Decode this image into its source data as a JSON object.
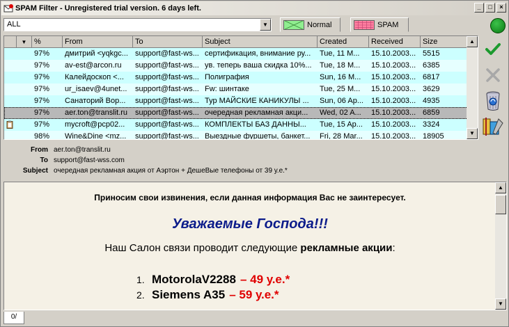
{
  "window": {
    "title": "SPAM Filter - Unregistered trial version. 6 days left."
  },
  "toolbar": {
    "filter_value": "ALL",
    "tab_normal": "Normal",
    "tab_spam": "SPAM",
    "colors": {
      "normal": "#90ee90",
      "spam": "#ff7fa0",
      "status": "#1a9a26"
    }
  },
  "list": {
    "headers": {
      "sort": "▼",
      "pct": "%",
      "from": "From",
      "to": "To",
      "subject": "Subject",
      "created": "Created",
      "received": "Received",
      "size": "Size"
    },
    "rows": [
      {
        "pct": "97%",
        "from": "дмитрий <yqkgc...",
        "to": "support@fast-ws...",
        "subject": "сертификация, внимание ру...",
        "created": "Tue, 11 M...",
        "received": "15.10.2003...",
        "size": "5515"
      },
      {
        "pct": "97%",
        "from": "av-est@arcon.ru",
        "to": "support@fast-ws...",
        "subject": "ув. теперь ваша скидка 10%...",
        "created": "Tue, 18 M...",
        "received": "15.10.2003...",
        "size": "6385"
      },
      {
        "pct": "97%",
        "from": "Калейдоскоп <...",
        "to": "support@fast-ws...",
        "subject": "Полиграфия",
        "created": "Sun, 16 M...",
        "received": "15.10.2003...",
        "size": "6817"
      },
      {
        "pct": "97%",
        "from": "ur_isaev@4unet...",
        "to": "support@fast-ws...",
        "subject": "Fw: шинтаке",
        "created": "Tue, 25 M...",
        "received": "15.10.2003...",
        "size": "3629"
      },
      {
        "pct": "97%",
        "from": "Санаторий Вор...",
        "to": "support@fast-ws...",
        "subject": "Тур МАЙСКИЕ КАНИКУЛЫ ...",
        "created": "Sun, 06 Ap...",
        "received": "15.10.2003...",
        "size": "4935"
      },
      {
        "pct": "97%",
        "from": "aer.ton@translit.ru",
        "to": "support@fast-ws...",
        "subject": "очередная рекламная акци...",
        "created": "Wed, 02 A...",
        "received": "15.10.2003...",
        "size": "6859"
      },
      {
        "pct": "97%",
        "from": "mycroft@pcp02...",
        "to": "support@fast-ws...",
        "subject": "КОМПЛЕКТЫ БАЗ ДАННЫ...",
        "created": "Tue, 15 Ap...",
        "received": "15.10.2003...",
        "size": "3324"
      },
      {
        "pct": "98%",
        "from": "Wine&Dine <mz...",
        "to": "support@fast-ws...",
        "subject": "Выездные фуршеты, банкет...",
        "created": "Fri, 28 Mar...",
        "received": "15.10.2003...",
        "size": "18905"
      }
    ]
  },
  "details": {
    "from_label": "From",
    "from_value": "aer.ton@translit.ru",
    "to_label": "To",
    "to_value": "support@fast-wss.com",
    "subject_label": "Subject",
    "subject_value": "очередная рекламная акция от Аэртон + ДешеВые телефоны от 39 у.е.*"
  },
  "preview": {
    "apology": "Приносим свои извинения, если данная информация Вас не заинтересует.",
    "greeting": "Уважаемые Господа!!!",
    "intro_start": "Наш Салон связи проводит следующие ",
    "intro_bold": "рекламные акции",
    "intro_end": ":",
    "items": [
      {
        "num": "1.",
        "name": "MotorolaV2288",
        "price": "–  49 у.е.*"
      },
      {
        "num": "2.",
        "name": "Siemens A35",
        "price": "–  59 у.е.*"
      }
    ]
  },
  "status": {
    "tab_label": "0/"
  }
}
